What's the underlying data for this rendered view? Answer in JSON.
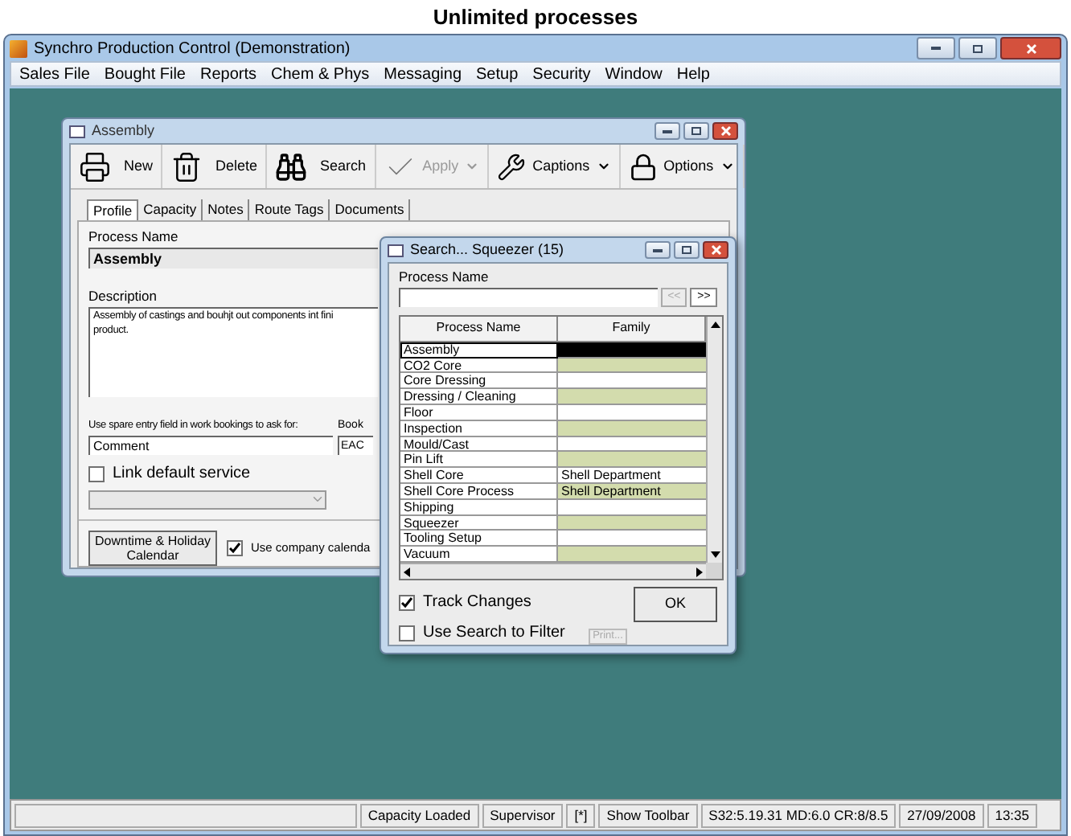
{
  "caption": "Unlimited processes",
  "window": {
    "title": "Synchro Production Control (Demonstration)"
  },
  "menu": [
    "Sales File",
    "Bought File",
    "Reports",
    "Chem & Phys",
    "Messaging",
    "Setup",
    "Security",
    "Window",
    "Help"
  ],
  "assembly": {
    "title": "Assembly",
    "toolbar": [
      {
        "kind": "new",
        "label": "New",
        "disabled": false,
        "dropdown": false
      },
      {
        "kind": "delete",
        "label": "Delete",
        "disabled": false,
        "dropdown": false
      },
      {
        "kind": "search",
        "label": "Search",
        "disabled": false,
        "dropdown": false
      },
      {
        "kind": "apply",
        "label": "Apply",
        "disabled": true,
        "dropdown": true
      },
      {
        "kind": "captions",
        "label": "Captions",
        "disabled": false,
        "dropdown": true
      },
      {
        "kind": "options",
        "label": "Options",
        "disabled": false,
        "dropdown": true
      }
    ],
    "tabs": [
      {
        "label": "Profile",
        "selected": true
      },
      {
        "label": "Capacity",
        "selected": false
      },
      {
        "label": "Notes",
        "selected": false
      },
      {
        "label": "Route Tags",
        "selected": false
      },
      {
        "label": "Documents",
        "selected": false
      }
    ],
    "process_name_label": "Process Name",
    "process_name": "Assembly",
    "description_label": "Description",
    "description_lines": [
      "Assembly of castings and bouhjt out components int fini",
      "product."
    ],
    "spare_label": "Use spare entry field in work bookings to ask for:",
    "spare_value": "Comment",
    "book_label": "Book",
    "book_value": "EAC",
    "link_default_service": {
      "label": "Link default service",
      "checked": false
    },
    "calendar_button": "Downtime & Holiday Calendar",
    "use_company_calendar": {
      "label": "Use company calenda",
      "checked": true
    }
  },
  "search": {
    "title": "Search... Squeezer (15)",
    "field_label": "Process Name",
    "prev": "<<",
    "next": ">>",
    "columns": [
      "Process Name",
      "Family"
    ],
    "rows": [
      {
        "name": "Assembly",
        "family": "",
        "selected": true
      },
      {
        "name": "CO2 Core",
        "family": "",
        "selected": false
      },
      {
        "name": "Core Dressing",
        "family": "",
        "selected": false
      },
      {
        "name": "Dressing / Cleaning",
        "family": "",
        "selected": false
      },
      {
        "name": "Floor",
        "family": "",
        "selected": false
      },
      {
        "name": "Inspection",
        "family": "",
        "selected": false
      },
      {
        "name": "Mould/Cast",
        "family": "",
        "selected": false
      },
      {
        "name": "Pin Lift",
        "family": "",
        "selected": false
      },
      {
        "name": "Shell Core",
        "family": "Shell Department",
        "selected": false
      },
      {
        "name": "Shell Core Process",
        "family": "Shell Department",
        "selected": false
      },
      {
        "name": "Shipping",
        "family": "",
        "selected": false
      },
      {
        "name": "Squeezer",
        "family": "",
        "selected": false
      },
      {
        "name": "Tooling Setup",
        "family": "",
        "selected": false
      },
      {
        "name": "Vacuum",
        "family": "",
        "selected": false
      }
    ],
    "track_changes": {
      "label": "Track Changes",
      "checked": true
    },
    "use_search_to_filter": {
      "label": "Use Search to Filter",
      "checked": false
    },
    "print_button": {
      "label": "Print...",
      "disabled": true
    },
    "ok_button": "OK"
  },
  "status_bar": [
    "Capacity Loaded",
    "Supervisor",
    "[*]",
    "Show Toolbar",
    "S32:5.19.31 MD:6.0 CR:8/8.5",
    "27/09/2008",
    "13:35"
  ]
}
